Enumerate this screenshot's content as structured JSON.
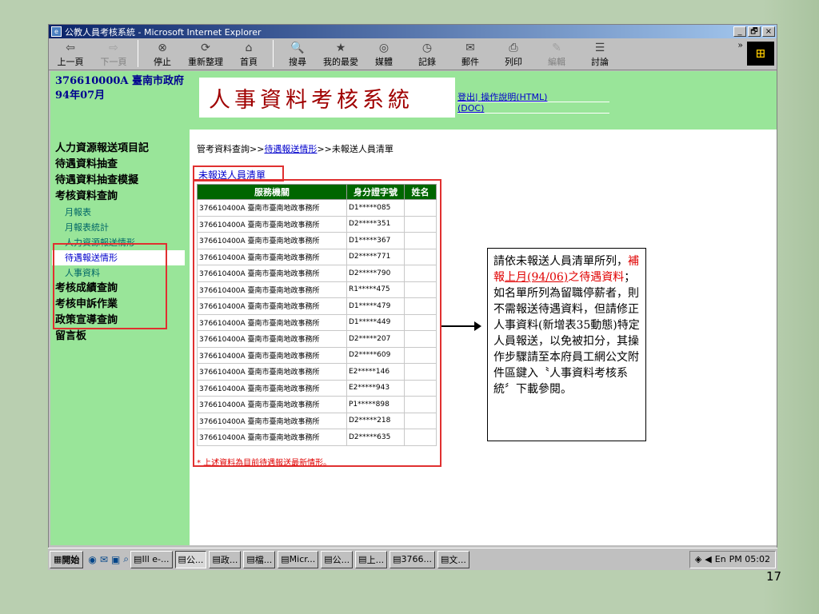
{
  "window": {
    "title": "公教人員考核系統 - Microsoft Internet Explorer",
    "minimize": "_",
    "maximize": "🗗",
    "close": "×"
  },
  "toolbar": {
    "buttons": [
      {
        "label": "上一頁",
        "icon": "back-arrow-icon",
        "glyph": "⇦",
        "disabled": false
      },
      {
        "label": "下一頁",
        "icon": "forward-arrow-icon",
        "glyph": "⇨",
        "disabled": true
      },
      {
        "label": "停止",
        "icon": "stop-icon",
        "glyph": "⊗",
        "disabled": false
      },
      {
        "label": "重新整理",
        "icon": "refresh-icon",
        "glyph": "⟳",
        "disabled": false
      },
      {
        "label": "首頁",
        "icon": "home-icon",
        "glyph": "⌂",
        "disabled": false
      },
      {
        "label": "搜尋",
        "icon": "search-icon",
        "glyph": "🔍",
        "disabled": false
      },
      {
        "label": "我的最愛",
        "icon": "favorites-icon",
        "glyph": "★",
        "disabled": false
      },
      {
        "label": "媒體",
        "icon": "media-icon",
        "glyph": "◎",
        "disabled": false
      },
      {
        "label": "記錄",
        "icon": "history-icon",
        "glyph": "◷",
        "disabled": false
      },
      {
        "label": "郵件",
        "icon": "mail-icon",
        "glyph": "✉",
        "disabled": false
      },
      {
        "label": "列印",
        "icon": "print-icon",
        "glyph": "⎙",
        "disabled": false
      },
      {
        "label": "編輯",
        "icon": "edit-icon",
        "glyph": "✎",
        "disabled": true
      },
      {
        "label": "討論",
        "icon": "discuss-icon",
        "glyph": "☰",
        "disabled": false
      }
    ],
    "chevron": "»"
  },
  "header": {
    "org_line1": "376610000A 臺南市政府",
    "period": "94年07月",
    "system_title": "人事資料考核系統",
    "link_logout": "登出",
    "separator": "|",
    "link_help": "操作說明(HTML)",
    "link_help2": "(DOC)"
  },
  "nav": {
    "items_top": [
      "人力資源報送項目記",
      "待遇資料抽查",
      "待遇資料抽查模擬",
      "考核資料查詢"
    ],
    "sub_items": [
      "月報表",
      "月報表統計",
      "人力資源報送情形",
      "待遇報送情形",
      "人事資料"
    ],
    "active_sub": "待遇報送情形",
    "items_bottom": [
      "考核成績查詢",
      "考核申訴作業",
      "政策宣導查詢",
      "留言板"
    ]
  },
  "breadcrumb": {
    "part1": "管考資料查詢>>",
    "link": "待遇報送情形",
    "part2": ">>未報送人員清單"
  },
  "list": {
    "title": "未報送人員清單",
    "headers": [
      "服務機關",
      "身分證字號",
      "姓名"
    ],
    "rows": [
      [
        "376610400A 臺南市臺南地政事務所",
        "D1*****085",
        ""
      ],
      [
        "376610400A 臺南市臺南地政事務所",
        "D2*****351",
        ""
      ],
      [
        "376610400A 臺南市臺南地政事務所",
        "D1*****367",
        ""
      ],
      [
        "376610400A 臺南市臺南地政事務所",
        "D2*****771",
        ""
      ],
      [
        "376610400A 臺南市臺南地政事務所",
        "D2*****790",
        ""
      ],
      [
        "376610400A 臺南市臺南地政事務所",
        "R1*****475",
        ""
      ],
      [
        "376610400A 臺南市臺南地政事務所",
        "D1*****479",
        ""
      ],
      [
        "376610400A 臺南市臺南地政事務所",
        "D1*****449",
        ""
      ],
      [
        "376610400A 臺南市臺南地政事務所",
        "D2*****207",
        ""
      ],
      [
        "376610400A 臺南市臺南地政事務所",
        "D2*****609",
        ""
      ],
      [
        "376610400A 臺南市臺南地政事務所",
        "E2*****146",
        ""
      ],
      [
        "376610400A 臺南市臺南地政事務所",
        "E2*****943",
        ""
      ],
      [
        "376610400A 臺南市臺南地政事務所",
        "P1*****898",
        ""
      ],
      [
        "376610400A 臺南市臺南地政事務所",
        "D2*****218",
        ""
      ],
      [
        "376610400A 臺南市臺南地政事務所",
        "D2*****635",
        ""
      ]
    ],
    "footnote": "* 上述資料為目前待遇報送最新情形。"
  },
  "callout": {
    "text1": "請依未報送人員清單所列，",
    "red1": "補報",
    "red_ul": "上月(94/06)",
    "red2": "之待遇資料",
    "text2": "；如名單所列為留職停薪者，則不需報送待遇資料，但請修正人事資料(新增表35動態)特定人員報送，以免被扣分，其操作步驟請至本府員工網公文附件區鍵入〝人事資料考核系統〞下載參閱。"
  },
  "taskbar": {
    "start": "開始",
    "buttons": [
      "Ill e-...",
      "公...",
      "政...",
      "檔...",
      "Micr...",
      "公...",
      "上...",
      "3766...",
      "文..."
    ],
    "tray_lang": "En",
    "clock": "PM 05:02"
  },
  "slide": {
    "page_number": "17"
  }
}
